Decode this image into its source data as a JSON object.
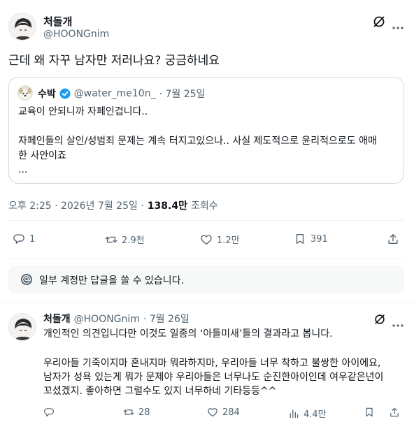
{
  "tweet": {
    "author_name": "처돌개",
    "author_handle": "@HOONGnim",
    "text": "근데 왜 자꾸 남자만 저러나요? 궁금하네요",
    "quote": {
      "author_name": "수박",
      "author_handle": "@water_me10n_",
      "date": "· 7월 25일",
      "line1": "교육이 안되니까 자페인겁니다..",
      "line2": "자페인들의 살인/성범죄 문제는 계속 터지고있으나.. 사실 제도적으로 윤리적으로도 애매",
      "line3": "한 사안이죠",
      "line4": "..."
    },
    "timestamp": "오후 2:25 · 2026년 7월 25일 ·",
    "views_count": "138.4만",
    "views_label": "조회수",
    "actions": {
      "reply_count": "1",
      "retweet_count": "2.9천",
      "like_count": "1.2만",
      "bookmark_count": "391"
    }
  },
  "notice": {
    "text": "일부 계정만 답글을 쓸 수 있습니다."
  },
  "reply": {
    "author_name": "처돌개",
    "author_handle": "@HOONGnim",
    "date": "· 7월 26일",
    "line1": "개인적인 의견입니다만 이것도 일종의 ‘아들미새’들의 결과라고 봅니다.",
    "line2": "우리아들 기죽이지마 혼내지마 뭐라하지마, 우리아들 너무 착하고 불쌍한 아이에요,",
    "line3": "남자가 성욕 있는게 뭐가 문제야 우리아들은 너무나도 순진한아이인데 여우같은년이",
    "line4": "꼬셨겠지. 좋아하면 그럴수도 있지 너무하네 기타등등^^",
    "actions": {
      "retweet_count": "28",
      "like_count": "284",
      "views_count": "4.4만"
    }
  },
  "colors": {
    "text": "#0f1419",
    "secondary": "#536471",
    "border": "#cfd9de",
    "verified": "#1d9bf0"
  }
}
